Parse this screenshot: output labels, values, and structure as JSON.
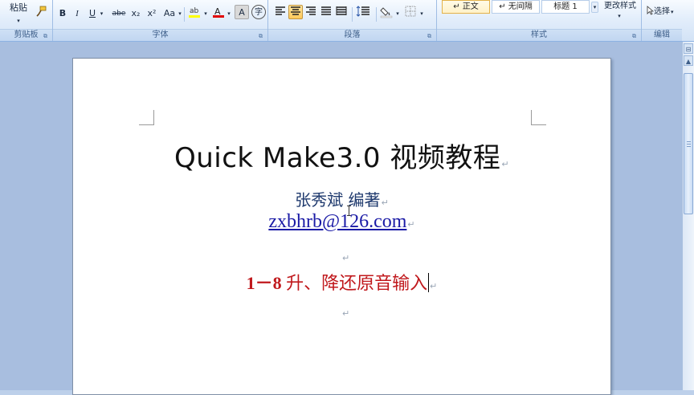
{
  "ribbon": {
    "clipboard": {
      "paste_label": "粘贴",
      "group_label": "剪贴板"
    },
    "font": {
      "group_label": "字体",
      "bold": "B",
      "italic": "I",
      "underline": "U",
      "strikethrough": "abe",
      "subscript": "x₂",
      "superscript": "x²",
      "change_case": "Aa",
      "font_color_letter": "A",
      "char_shading": "A",
      "phonetic": "字"
    },
    "paragraph": {
      "group_label": "段落"
    },
    "styles": {
      "group_label": "样式",
      "items": [
        "↵ 正文",
        "↵ 无间隔",
        "标题 1"
      ],
      "change_styles": "更改样式"
    },
    "editing": {
      "select_label": "选择",
      "group_label": "编辑"
    }
  },
  "document": {
    "title": "Quick Make3.0 视频教程",
    "author": "张秀斌 编著",
    "email": "zxbhrb@126.com",
    "lesson_number": "1－8",
    "lesson_title": "升、降还原音输入",
    "paragraph_mark": "↵"
  },
  "colors": {
    "lesson_red": "#c0181c",
    "link_blue": "#1a1aa6",
    "highlight_yellow": "#ffff00",
    "font_red": "#e00000"
  },
  "icons": [
    "format-painter-icon",
    "highlight-icon",
    "font-color-icon",
    "align-left-icon",
    "align-center-icon",
    "align-right-icon",
    "justify-icon",
    "distributed-icon",
    "line-spacing-icon",
    "shading-icon",
    "borders-icon",
    "select-arrow-icon",
    "ibeam-cursor-icon"
  ]
}
